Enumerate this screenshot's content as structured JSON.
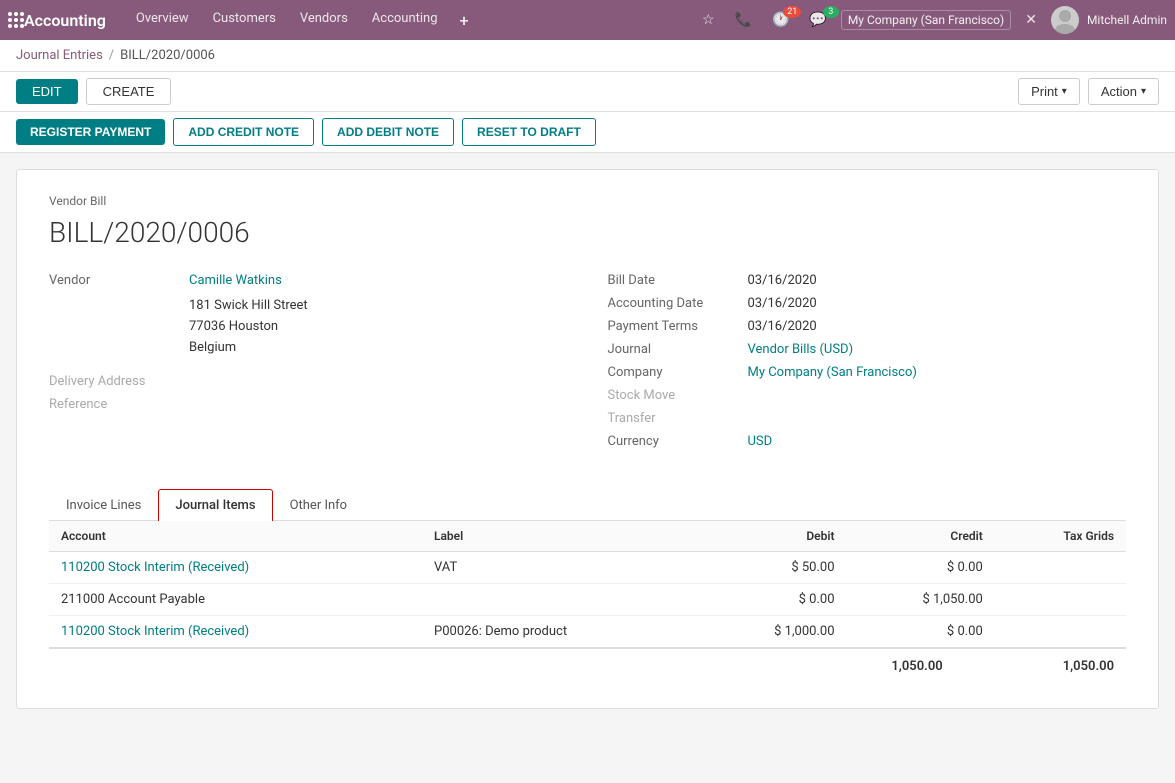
{
  "app": {
    "title": "Accounting",
    "nav": {
      "links": [
        "Overview",
        "Customers",
        "Vendors",
        "Accounting"
      ],
      "company": "My Company (San Francisco)",
      "user": "Mitchell Admin",
      "badge_21": "21",
      "badge_3": "3"
    }
  },
  "breadcrumb": {
    "parent": "Journal Entries",
    "current": "BILL/2020/0006"
  },
  "toolbar": {
    "edit_label": "EDIT",
    "create_label": "CREATE",
    "print_label": "Print",
    "action_label": "Action"
  },
  "secondary_toolbar": {
    "register_label": "REGISTER PAYMENT",
    "credit_note_label": "ADD CREDIT NOTE",
    "debit_note_label": "ADD DEBIT NOTE",
    "reset_label": "RESET TO DRAFT"
  },
  "document": {
    "doc_type": "Vendor Bill",
    "doc_title": "BILL/2020/0006",
    "vendor_label": "Vendor",
    "vendor_name": "Camille Watkins",
    "vendor_address_1": "181 Swick Hill Street",
    "vendor_address_2": "77036 Houston",
    "vendor_address_3": "Belgium",
    "delivery_address_label": "Delivery Address",
    "reference_label": "Reference",
    "bill_date_label": "Bill Date",
    "bill_date": "03/16/2020",
    "accounting_date_label": "Accounting Date",
    "accounting_date": "03/16/2020",
    "payment_terms_label": "Payment Terms",
    "payment_terms": "03/16/2020",
    "journal_label": "Journal",
    "journal_value": "Vendor Bills (USD)",
    "company_label": "Company",
    "company_value": "My Company (San Francisco)",
    "stock_move_label": "Stock Move",
    "transfer_label": "Transfer",
    "currency_label": "Currency",
    "currency_value": "USD"
  },
  "tabs": {
    "invoice_lines": "Invoice Lines",
    "journal_items": "Journal Items",
    "other_info": "Other Info"
  },
  "table": {
    "headers": {
      "account": "Account",
      "label": "Label",
      "debit": "Debit",
      "credit": "Credit",
      "tax_grids": "Tax Grids"
    },
    "rows": [
      {
        "account": "110200 Stock Interim (Received)",
        "label": "VAT",
        "debit": "$ 50.00",
        "credit": "$ 0.00",
        "tax_grids": "",
        "account_link": true
      },
      {
        "account": "211000 Account Payable",
        "label": "",
        "debit": "$ 0.00",
        "credit": "$ 1,050.00",
        "tax_grids": "",
        "account_link": false
      },
      {
        "account": "110200 Stock Interim (Received)",
        "label": "P00026: Demo product",
        "debit": "$ 1,000.00",
        "credit": "$ 0.00",
        "tax_grids": "",
        "account_link": true
      }
    ],
    "totals": {
      "debit": "1,050.00",
      "credit": "1,050.00"
    }
  }
}
